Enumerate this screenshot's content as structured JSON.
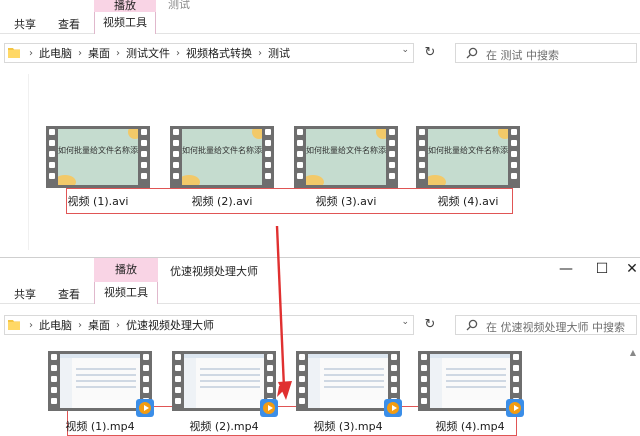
{
  "window1": {
    "title": "测试",
    "ribbon": {
      "tab_share": "共享",
      "tab_view": "查看",
      "context_header": "播放",
      "context_tab": "视频工具"
    },
    "breadcrumb": [
      "此电脑",
      "桌面",
      "测试文件",
      "视频格式转换",
      "测试"
    ],
    "search_placeholder": "在 测试 中搜索",
    "files": [
      {
        "name": "视频 (1).avi",
        "thumb_title": "如何批量给文件名称添加序号"
      },
      {
        "name": "视频 (2).avi",
        "thumb_title": "如何批量给文件名称添加序号"
      },
      {
        "name": "视频 (3).avi",
        "thumb_title": "如何批量给文件名称添加序号"
      },
      {
        "name": "视频 (4).avi",
        "thumb_title": "如何批量给文件名称添加序号"
      }
    ]
  },
  "window2": {
    "title": "优速视频处理大师",
    "ribbon": {
      "tab_share": "共享",
      "tab_view": "查看",
      "context_header": "播放",
      "context_tab": "视频工具"
    },
    "controls": {
      "minimize": "—",
      "maximize": "☐",
      "close": "✕"
    },
    "breadcrumb": [
      "此电脑",
      "桌面",
      "优速视频处理大师"
    ],
    "search_placeholder": "在 优速视频处理大师 中搜索",
    "files": [
      {
        "name": "视频 (1).mp4"
      },
      {
        "name": "视频 (2).mp4"
      },
      {
        "name": "视频 (3).mp4"
      },
      {
        "name": "视频 (4).mp4"
      }
    ]
  },
  "colors": {
    "context_tab": "#f9d4e5",
    "highlight_box": "#e05555",
    "arrow": "#e03030"
  },
  "icons": [
    "folder-icon",
    "chevron-right-icon",
    "chevron-down-icon",
    "refresh-icon",
    "search-icon",
    "play-badge-icon"
  ]
}
